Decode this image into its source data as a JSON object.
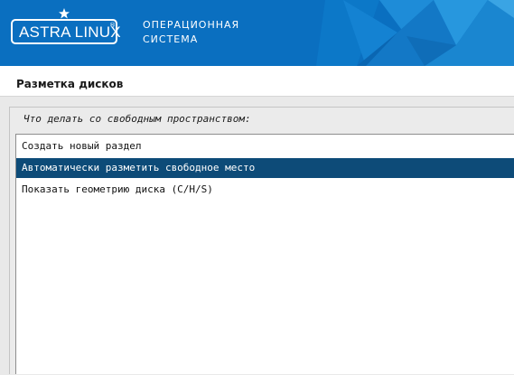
{
  "header": {
    "logo_text": "ASTRA LINUX",
    "logo_reg": "®",
    "subtitle_line1": "ОПЕРАЦИОННАЯ",
    "subtitle_line2": "СИСТЕМА",
    "banner_color": "#0a6fc0"
  },
  "page": {
    "title": "Разметка дисков"
  },
  "prompt": {
    "question": "Что делать со свободным пространством:"
  },
  "options": [
    {
      "label": "Создать новый раздел",
      "selected": false
    },
    {
      "label": "Автоматически разметить свободное место",
      "selected": true
    },
    {
      "label": "Показать геометрию диска (C/H/S)",
      "selected": false
    }
  ],
  "colors": {
    "selection": "#0d4b78"
  }
}
